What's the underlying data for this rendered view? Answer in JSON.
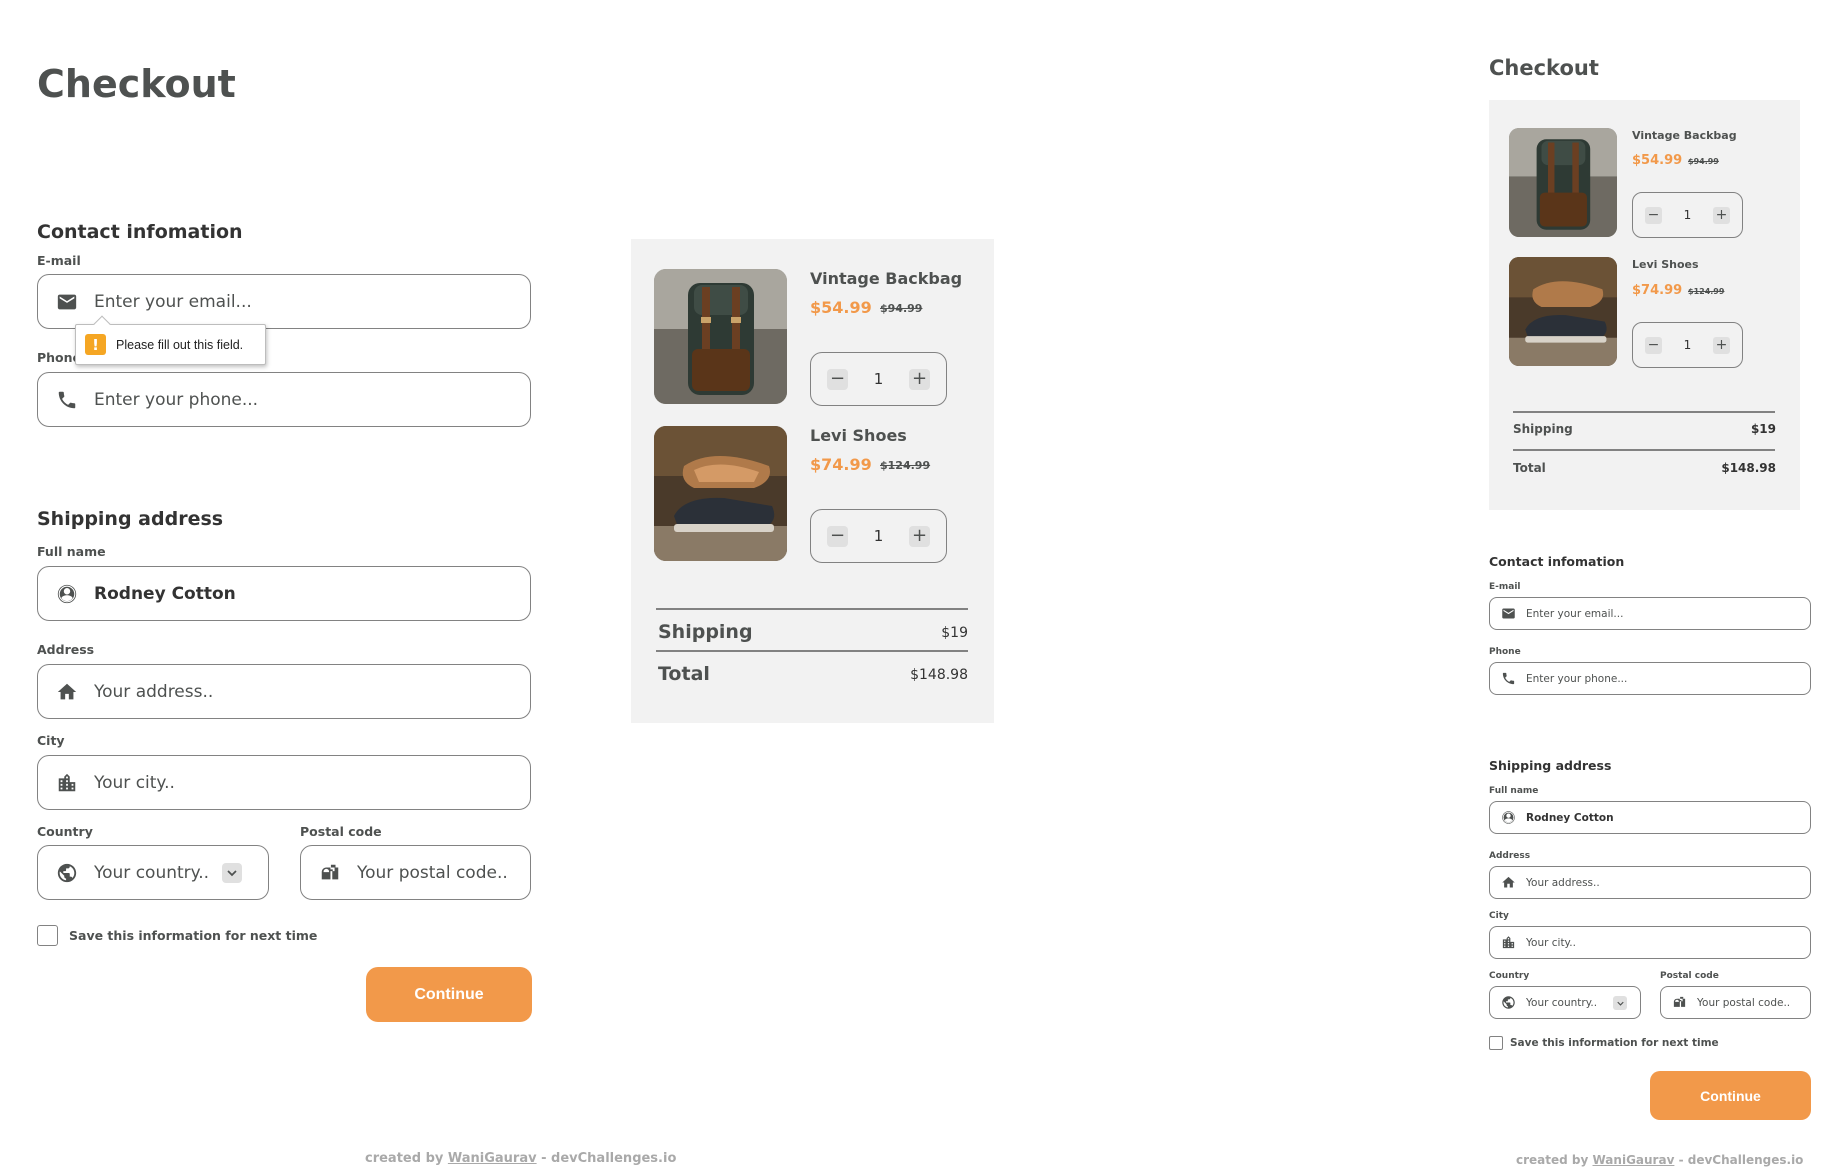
{
  "title": "Checkout",
  "contact": {
    "heading": "Contact infomation",
    "email_label": "E-mail",
    "email_placeholder": "Enter your email...",
    "email_placeholder_mobile": "Enter your email...",
    "phone_label": "Phone",
    "phone_placeholder": "Enter your phone...",
    "validation_message": "Please fill out this field."
  },
  "shipping": {
    "heading": "Shipping address",
    "fullname_label": "Full name",
    "fullname_value": "Rodney Cotton",
    "address_label": "Address",
    "address_placeholder": "Your address..",
    "city_label": "City",
    "city_placeholder": "Your city..",
    "country_label": "Country",
    "country_placeholder": "Your country..",
    "postal_label": "Postal code",
    "postal_placeholder": "Your postal code.."
  },
  "save_info_label": "Save this information for next time",
  "continue_label": "Continue",
  "cart": {
    "items": [
      {
        "name": "Vintage Backbag",
        "price": "$54.99",
        "old_price": "$94.99",
        "qty": "1",
        "minus": "−",
        "plus": "+"
      },
      {
        "name": "Levi Shoes",
        "price": "$74.99",
        "old_price": "$124.99",
        "qty": "1",
        "minus": "−",
        "plus": "+"
      }
    ],
    "shipping_label": "Shipping",
    "shipping_value": "$19",
    "total_label": "Total",
    "total_value": "$148.98"
  },
  "credit": {
    "prefix": "created by ",
    "author": "WaniGaurav",
    "suffix": " - devChallenges.io"
  },
  "colors": {
    "accent": "#f2994a",
    "panel": "#f2f2f2",
    "border": "#828282",
    "text": "#4e5150"
  },
  "icons": {
    "email": "mail-icon",
    "phone": "phone-icon",
    "fullname": "account-circle-icon",
    "address": "home-icon",
    "city": "location-city-icon",
    "country": "globe-icon",
    "postal": "mailbox-icon",
    "dropdown": "chevron-down-icon",
    "warning": "warning-icon"
  }
}
